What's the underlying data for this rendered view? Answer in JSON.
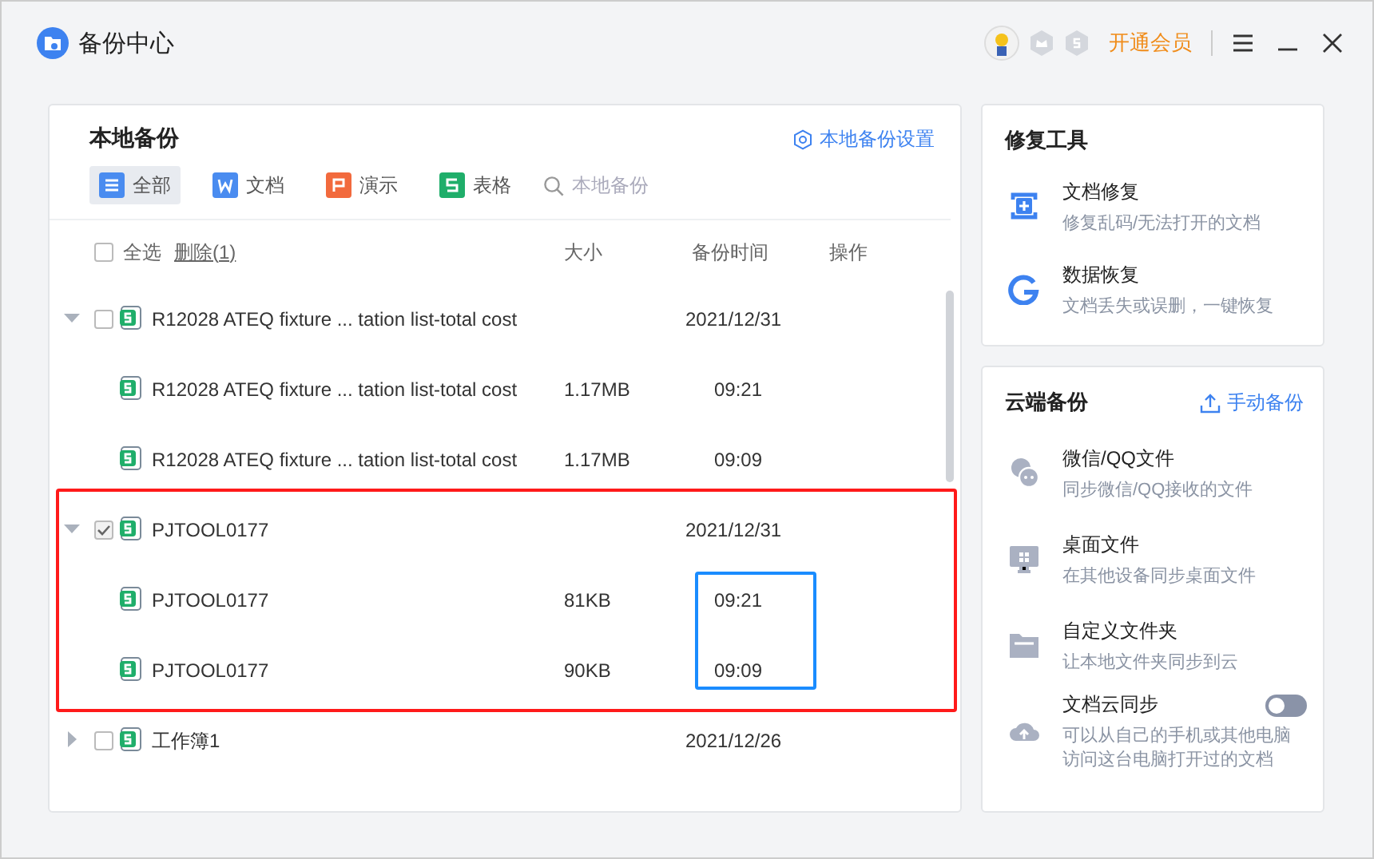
{
  "window": {
    "title": "备份中心",
    "vip_label": "开通会员"
  },
  "local_backup": {
    "title": "本地备份",
    "settings_link": "本地备份设置",
    "filters": [
      {
        "label": "全部",
        "kind": "all",
        "selected": true
      },
      {
        "label": "文档",
        "kind": "doc",
        "selected": false
      },
      {
        "label": "演示",
        "kind": "ppt",
        "selected": false
      },
      {
        "label": "表格",
        "kind": "sheet",
        "selected": false
      }
    ],
    "search": {
      "placeholder": "本地备份"
    },
    "table": {
      "select_all": {
        "label": "全选",
        "checked": false
      },
      "delete_link": "删除(1)",
      "columns": [
        "大小",
        "备份时间",
        "操作"
      ],
      "groups": [
        {
          "kind": "sheet",
          "name": "R12028 ATEQ fixture ... tation list-total cost",
          "date": "2021/12/31",
          "expanded": true,
          "checked": false,
          "children": [
            {
              "kind": "sheet",
              "name": "R12028 ATEQ fixture ... tation list-total cost",
              "size": "1.17MB",
              "time": "09:21"
            },
            {
              "kind": "sheet",
              "name": "R12028 ATEQ fixture ... tation list-total cost",
              "size": "1.17MB",
              "time": "09:09"
            }
          ]
        },
        {
          "kind": "sheet",
          "name": "PJTOOL0177",
          "date": "2021/12/31",
          "expanded": true,
          "checked": true,
          "highlighted": true,
          "times_highlighted": true,
          "children": [
            {
              "kind": "sheet",
              "name": "PJTOOL0177",
              "size": "81KB",
              "time": "09:21"
            },
            {
              "kind": "sheet",
              "name": "PJTOOL0177",
              "size": "90KB",
              "time": "09:09"
            }
          ]
        },
        {
          "kind": "sheet",
          "name": "工作簿1",
          "date": "2021/12/26",
          "expanded": false,
          "checked": false
        }
      ]
    }
  },
  "repair_tools": {
    "title": "修复工具",
    "items": [
      {
        "kind": "repair",
        "title": "文档修复",
        "desc": "修复乱码/无法打开的文档"
      },
      {
        "kind": "recover",
        "title": "数据恢复",
        "desc": "文档丢失或误删，一键恢复"
      }
    ]
  },
  "cloud_backup": {
    "title": "云端备份",
    "manual_button": "手动备份",
    "items": [
      {
        "kind": "chat",
        "title": "微信/QQ文件",
        "desc": "同步微信/QQ接收的文件"
      },
      {
        "kind": "desktop",
        "title": "桌面文件",
        "desc": "在其他设备同步桌面文件"
      },
      {
        "kind": "folder",
        "title": "自定义文件夹",
        "desc": "让本地文件夹同步到云"
      },
      {
        "kind": "cloud",
        "title": "文档云同步",
        "desc": "可以从自己的手机或其他电脑访问这台电脑打开过的文档",
        "on": false
      }
    ]
  }
}
